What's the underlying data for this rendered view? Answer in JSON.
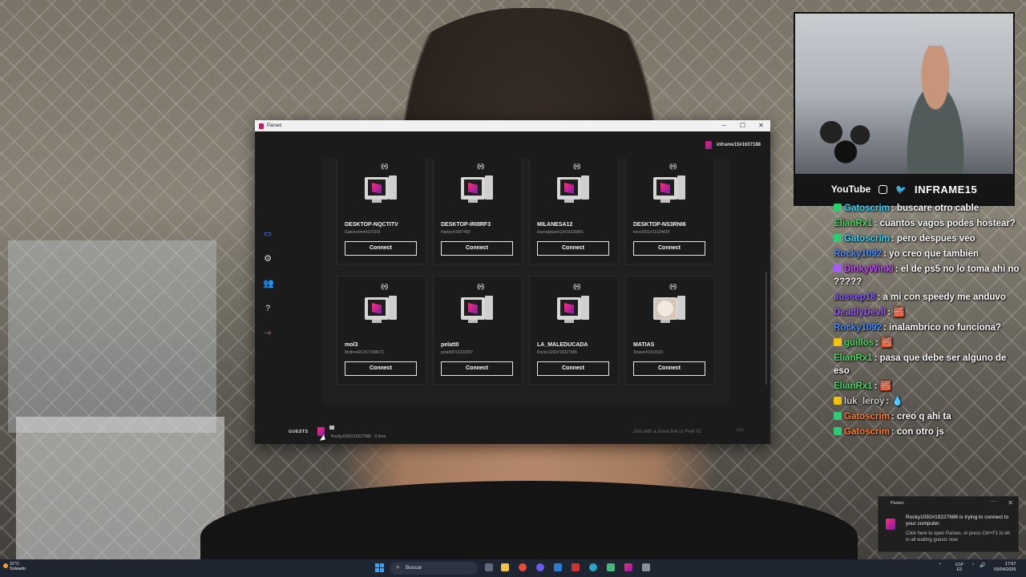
{
  "window": {
    "app_title": "Parsec",
    "account": "inframe15#1637188"
  },
  "computers": [
    {
      "name": "DESKTOP-NQCTITV",
      "id": "Gatoscrim#4197331",
      "button": "Connect",
      "avatar": "monitor-icon"
    },
    {
      "name": "DESKTOP-IRI8RF3",
      "id": "Harley#3307492",
      "button": "Connect",
      "avatar": "monitor-icon"
    },
    {
      "name": "MILANESA12",
      "id": "ibarradylann12#19226891",
      "button": "Connect",
      "avatar": "monitor-icon"
    },
    {
      "name": "DESKTOP-NS3RNI6",
      "id": "kevz2011#11124429",
      "button": "Connect",
      "avatar": "monitor-icon"
    },
    {
      "name": "mol3",
      "id": "MoltresRC#17349672",
      "button": "Connect",
      "avatar": "monitor-icon"
    },
    {
      "name": "pelatt0",
      "id": "pelatt0#13320007",
      "button": "Connect",
      "avatar": "monitor-icon"
    },
    {
      "name": "LA_MALEDUCADA",
      "id": "Rocky1092#19227686",
      "button": "Connect",
      "avatar": "monitor-icon"
    },
    {
      "name": "MATIAS",
      "id": "Strawn#1011521",
      "button": "Connect",
      "avatar": "dog-photo"
    }
  ],
  "bottom": {
    "guests_label": "GUESTS",
    "guest_tooltip": "Rocky1092#19227686 · 0.0ms",
    "join_placeholder": "Join with a share link or Peer ID",
    "join_button": "Join"
  },
  "webcam": {
    "youtube": "YouTube",
    "brand": "INFRAME15"
  },
  "chat": [
    {
      "user": "Gatoscrim",
      "msg": ": buscare otro cable",
      "color": "#33d7ff",
      "badge": "#2ecc71"
    },
    {
      "user": "ElianRx1",
      "msg": ": cuantos vagos podes hostear?",
      "color": "#4cd964",
      "badge": ""
    },
    {
      "user": "Gatoscrim",
      "msg": ": pero despues veo",
      "color": "#33d7ff",
      "badge": "#2ecc71"
    },
    {
      "user": "Rocky1092",
      "msg": ": yo creo que tambien",
      "color": "#4c8dff",
      "badge": ""
    },
    {
      "user": "DinkyWinki",
      "msg": ": el de ps5 no lo toma ahi no ?????",
      "color": "#c34cff",
      "badge": "#a35bff"
    },
    {
      "user": "Jussep18",
      "msg": ": a mi con speedy me anduvo",
      "color": "#8a5bff",
      "badge": ""
    },
    {
      "user": "DeadlyDevil",
      "msg": ": 🧱",
      "color": "#9b59ff",
      "badge": ""
    },
    {
      "user": "Rocky1092",
      "msg": ": inalambrico no funciona?",
      "color": "#4c8dff",
      "badge": ""
    },
    {
      "user": "guillos",
      "msg": ": 🧱",
      "color": "#4cd964",
      "badge": "#f1c40f"
    },
    {
      "user": "ElianRx1",
      "msg": ": pasa que debe ser alguno de eso",
      "color": "#4cd964",
      "badge": ""
    },
    {
      "user": "ElianRx1",
      "msg": ": 🧱",
      "color": "#4cd964",
      "badge": ""
    },
    {
      "user": "luk_leroy",
      "msg": ": 💧",
      "color": "#cccccc",
      "badge": "#f1c40f"
    },
    {
      "user": "Gatoscrim",
      "msg": ": creo q ahi ta",
      "color": "#ff7f3a",
      "badge": "#2ecc71"
    },
    {
      "user": "Gatoscrim",
      "msg": ": con otro js",
      "color": "#ff7f3a",
      "badge": "#2ecc71"
    }
  ],
  "notification": {
    "app": "Parsec",
    "message": "Rocky1092#19227686 is trying to connect to your computer.",
    "sub": "Click here to open Parsec, or press Ctrl+F1 to let in all waiting guests now."
  },
  "taskbar": {
    "temp": "21°C",
    "weather": "Soleado",
    "search_placeholder": "Buscar",
    "lang_top": "ESP",
    "lang_bottom": "ES",
    "time": "17:57",
    "date": "03/04/2026"
  }
}
